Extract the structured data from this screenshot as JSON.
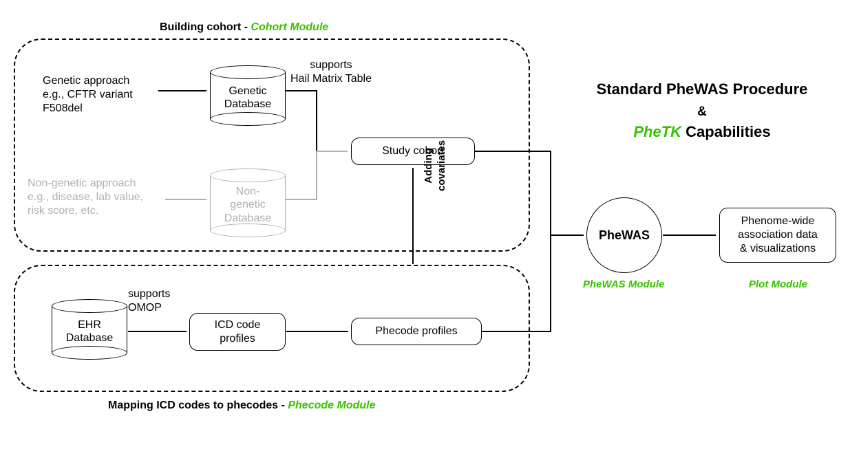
{
  "title": {
    "line1": "Standard PheWAS Procedure",
    "amp": "&",
    "line2_green": "PheTK",
    "line2_rest": " Capabilities"
  },
  "groups": {
    "cohort_label": "Building cohort - ",
    "cohort_module": "Cohort Module",
    "phecode_label": "Mapping ICD codes to phecodes - ",
    "phecode_module": "Phecode Module"
  },
  "inputs": {
    "genetic_approach": "Genetic approach\ne.g., CFTR variant\nF508del",
    "nongenetic_approach": "Non-genetic approach\ne.g., disease, lab value,\nrisk score, etc."
  },
  "databases": {
    "genetic": "Genetic\nDatabase",
    "nongenetic": "Non-\ngenetic\nDatabase",
    "ehr": "EHR\nDatabase"
  },
  "notes": {
    "hail": "supports\nHail Matrix Table",
    "omop": "supports\nOMOP",
    "adding_cov": "Adding\ncovariates"
  },
  "nodes": {
    "study_cohort": "Study cohort",
    "icd_profiles": "ICD code\nprofiles",
    "phecode_profiles": "Phecode profiles",
    "phewas": "PheWAS",
    "output": "Phenome-wide\nassociation data\n& visualizations"
  },
  "modules": {
    "phewas": "PheWAS Module",
    "plot": "Plot Module"
  }
}
